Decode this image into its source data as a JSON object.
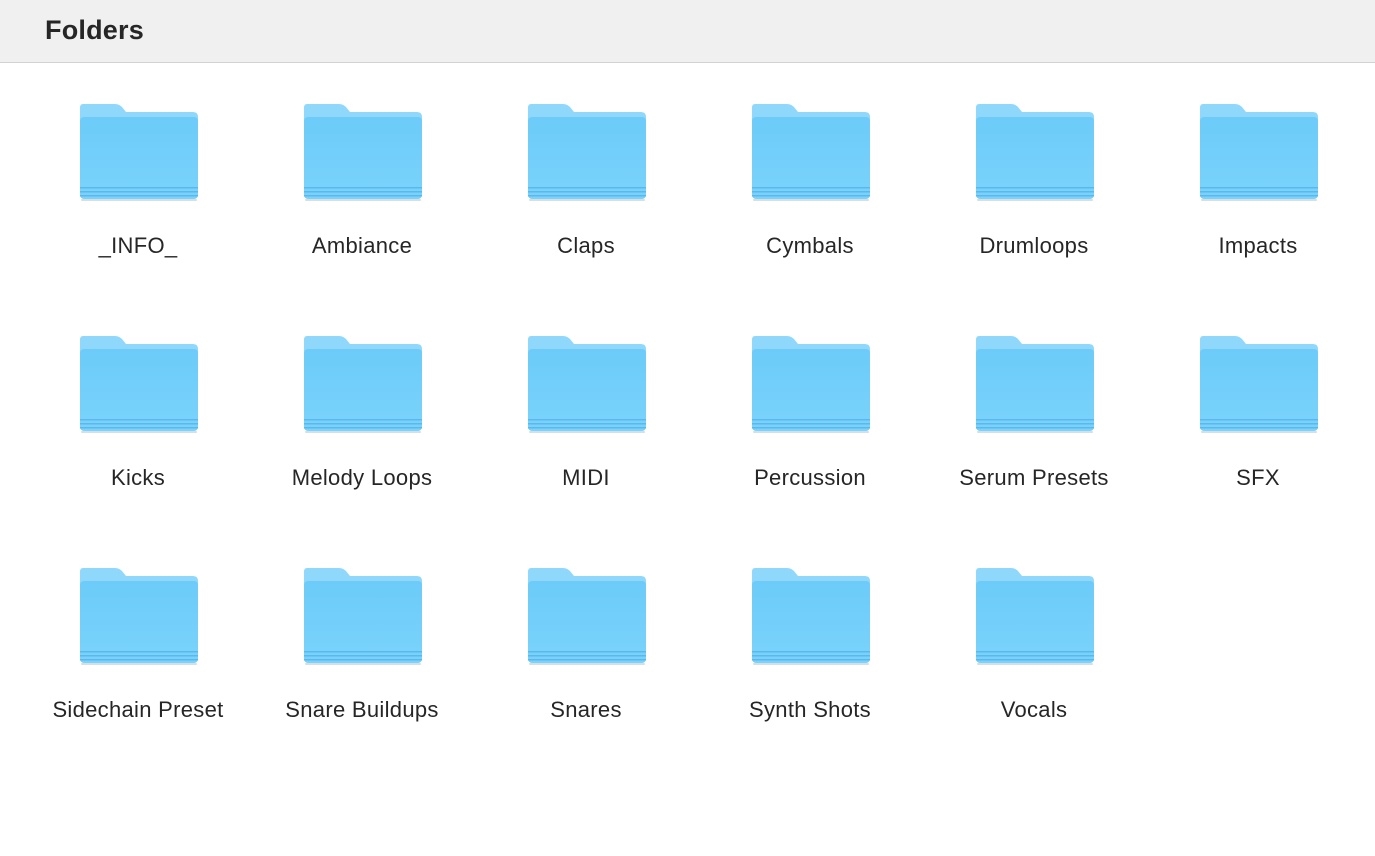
{
  "header": {
    "title": "Folders"
  },
  "folder_icon": {
    "name": "folder-icon",
    "color_back": "#8fd8fb",
    "color_front": "#6ccbf9",
    "color_stripe": "#5ab8ec"
  },
  "folders": [
    {
      "name": "_INFO_"
    },
    {
      "name": "Ambiance"
    },
    {
      "name": "Claps"
    },
    {
      "name": "Cymbals"
    },
    {
      "name": "Drumloops"
    },
    {
      "name": "Impacts"
    },
    {
      "name": "Kicks"
    },
    {
      "name": "Melody Loops"
    },
    {
      "name": "MIDI"
    },
    {
      "name": "Percussion"
    },
    {
      "name": "Serum Presets"
    },
    {
      "name": "SFX"
    },
    {
      "name": "Sidechain Preset"
    },
    {
      "name": "Snare Buildups"
    },
    {
      "name": "Snares"
    },
    {
      "name": "Synth Shots"
    },
    {
      "name": "Vocals"
    }
  ]
}
